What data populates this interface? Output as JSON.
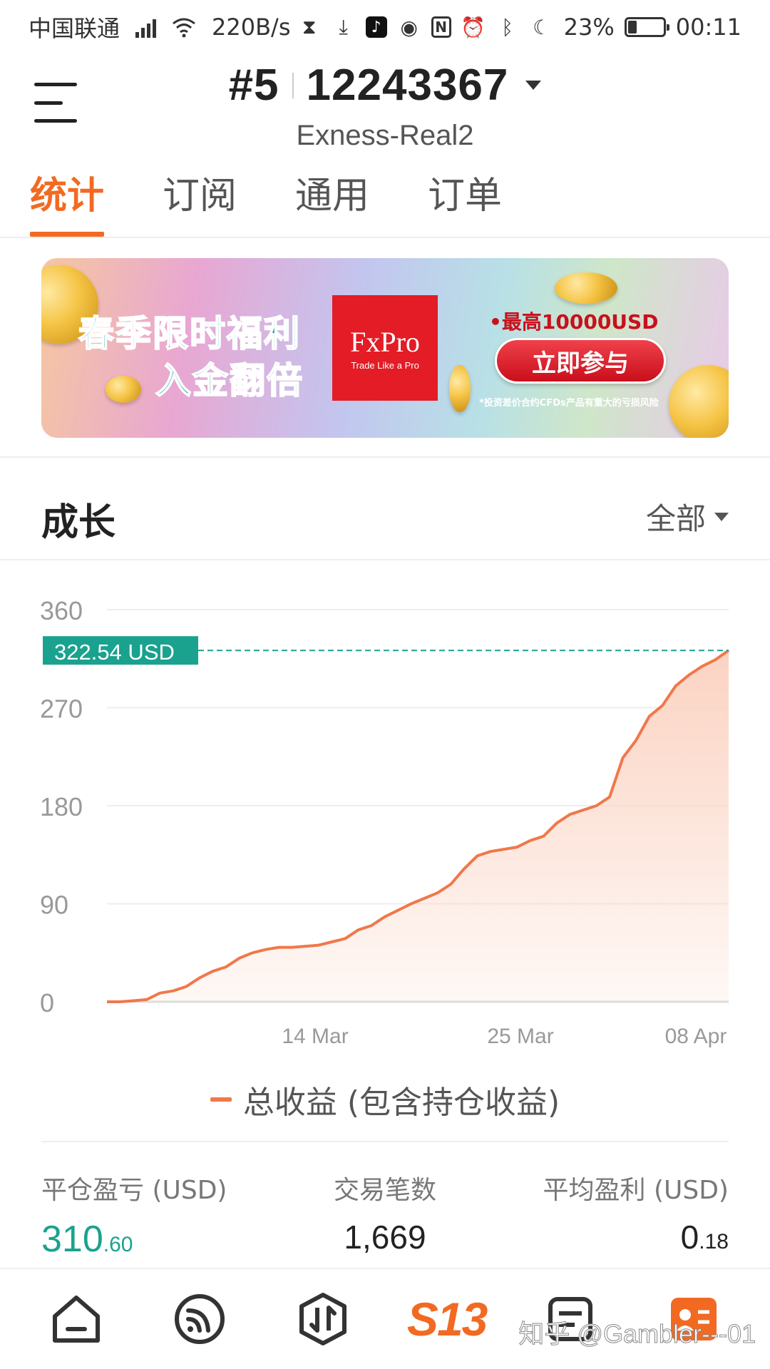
{
  "status_bar": {
    "carrier": "中国联通",
    "speed": "220B/s",
    "battery": "23%",
    "battery_level": 0.23,
    "time": "00:11"
  },
  "header": {
    "rank": "#5",
    "account": "12243367",
    "server": "Exness-Real2"
  },
  "tabs": [
    {
      "label": "统计",
      "active": true
    },
    {
      "label": "订阅",
      "active": false
    },
    {
      "label": "通用",
      "active": false
    },
    {
      "label": "订单",
      "active": false
    }
  ],
  "banner": {
    "title_line1": "春季限时福利",
    "title_line2": "入金翻倍",
    "brand": "FxPro",
    "brand_tagline": "Trade Like a Pro",
    "max_text": "•最高10000USD",
    "cta": "立即参与",
    "risk_note": "*投资差价合约CFDs产品有重大的亏损风险"
  },
  "growth": {
    "title": "成长",
    "range": "全部"
  },
  "chart_data": {
    "type": "area",
    "y_ticks": [
      "360",
      "270",
      "180",
      "90",
      "0"
    ],
    "ylim": [
      0,
      360
    ],
    "x_ticks": [
      "14 Mar",
      "25 Mar",
      "08 Apr"
    ],
    "current_value_label": "322.54 USD",
    "current_value": 322.54,
    "colors": {
      "line": "#f0784a",
      "fill": "#fbd3c2",
      "marker": "#1aa28e"
    },
    "series": [
      {
        "name": "总收益 (包含持仓收益)",
        "values": [
          0,
          0,
          1,
          2,
          8,
          10,
          14,
          22,
          28,
          32,
          40,
          45,
          48,
          50,
          50,
          51,
          52,
          55,
          58,
          66,
          70,
          78,
          84,
          90,
          95,
          100,
          108,
          122,
          134,
          138,
          140,
          142,
          148,
          152,
          164,
          172,
          176,
          180,
          188,
          224,
          240,
          262,
          272,
          290,
          300,
          308,
          314,
          322.54
        ]
      }
    ]
  },
  "legend": {
    "label": "总收益 (包含持仓收益)"
  },
  "stats": [
    {
      "label": "平仓盈亏 (USD)",
      "value_int": "310",
      "value_dec": ".60",
      "positive": true
    },
    {
      "label": "交易笔数",
      "value_int": "1,669",
      "value_dec": "",
      "positive": false
    },
    {
      "label": "平均盈利 (USD)",
      "value_int": "0",
      "value_dec": ".18",
      "positive": false
    }
  ],
  "bottom_nav": [
    {
      "icon": "home-icon"
    },
    {
      "icon": "signal-feed-icon"
    },
    {
      "icon": "trade-icon"
    },
    {
      "icon": "s13-logo"
    },
    {
      "icon": "news-icon"
    },
    {
      "icon": "profile-icon"
    }
  ],
  "watermark": "知乎 @Gambler---01"
}
